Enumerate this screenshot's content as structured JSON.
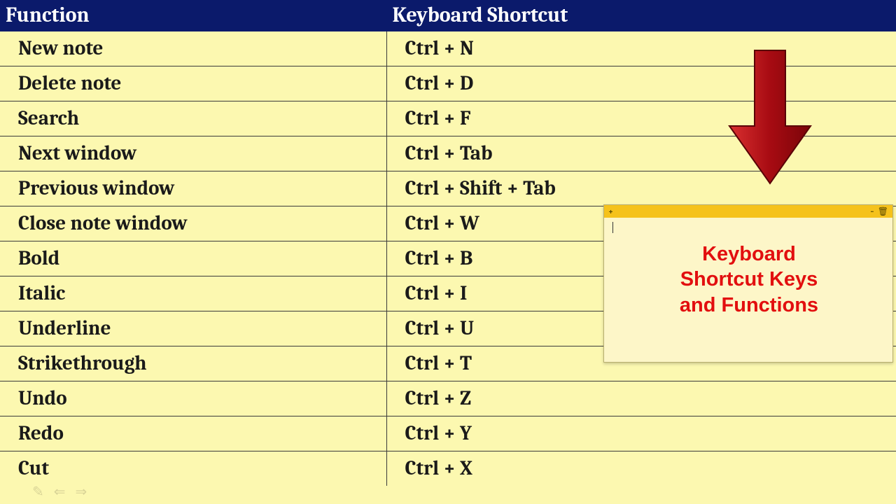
{
  "table": {
    "headers": {
      "function": "Function",
      "shortcut": "Keyboard Shortcut"
    },
    "rows": [
      {
        "function": "New note",
        "shortcut": "Ctrl + N"
      },
      {
        "function": "Delete note",
        "shortcut": "Ctrl + D"
      },
      {
        "function": "Search",
        "shortcut": "Ctrl + F"
      },
      {
        "function": "Next window",
        "shortcut": "Ctrl + Tab"
      },
      {
        "function": "Previous window",
        "shortcut": "Ctrl + Shift + Tab"
      },
      {
        "function": "Close note window",
        "shortcut": "Ctrl + W"
      },
      {
        "function": "Bold",
        "shortcut": "Ctrl + B"
      },
      {
        "function": "Italic",
        "shortcut": "Ctrl + I"
      },
      {
        "function": "Underline",
        "shortcut": "Ctrl + U"
      },
      {
        "function": "Strikethrough",
        "shortcut": "Ctrl + T"
      },
      {
        "function": "Undo",
        "shortcut": "Ctrl + Z"
      },
      {
        "function": "Redo",
        "shortcut": "Ctrl + Y"
      },
      {
        "function": "Cut",
        "shortcut": "Ctrl + X"
      }
    ]
  },
  "sticky": {
    "plus": "+",
    "dots": "···",
    "trash": "🗑",
    "caption": "Keyboard\nShortcut Keys\nand Functions"
  },
  "nav": {
    "pen": "✎",
    "prev": "⇐",
    "next": "⇒"
  },
  "colors": {
    "header_bg": "#0b1a6b",
    "accent_red": "#b30c13"
  }
}
